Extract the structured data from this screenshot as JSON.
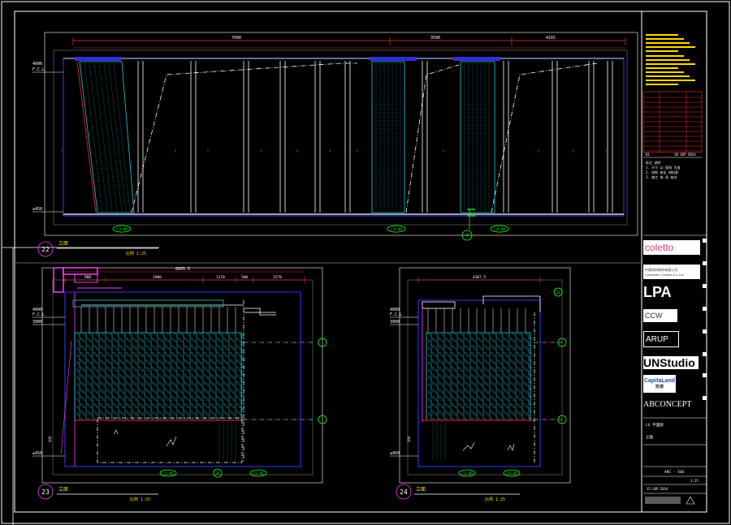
{
  "colors": {
    "background": "#000000",
    "frame": "#ffffff",
    "red": "#ff2a2a",
    "blue": "#2f2fd8",
    "cyan": "#26c9d6",
    "green": "#1aff1a",
    "magenta": "#ff3cff",
    "yellow": "#ffd800",
    "grey": "#7a7a7a"
  },
  "views": {
    "v22": {
      "number": "22",
      "title": "立面",
      "scale": "比例  1:25",
      "dims": [
        "7090",
        "3590",
        "4165"
      ],
      "level_top": [
        "4000",
        "F.C.L"
      ],
      "level_bottom": "±450",
      "tags": [
        "门1-04",
        "门1-09",
        "门1-09"
      ],
      "section_tag": "23"
    },
    "v23": {
      "number": "23",
      "title": "立面",
      "scale": "比例  1:25",
      "dims_top": "6895.5",
      "dims": [
        "900",
        "2900",
        "1170",
        "500",
        "1570"
      ],
      "level_top": [
        "4000",
        "F.C.L"
      ],
      "level_mid": "3900",
      "level_bottom": "±450",
      "side_dim": "200",
      "tags": [
        "门1-05",
        "门1-05"
      ],
      "section_tag": "24"
    },
    "v24": {
      "number": "24",
      "title": "立面",
      "scale": "比例  1:25",
      "dims_top": "4307.5",
      "level_top": [
        "4000",
        "F.C.L"
      ],
      "level_mid": "3900",
      "level_bottom": "±450",
      "side_dim": "200",
      "tags": [
        "门1-05",
        "门1-05"
      ],
      "section_tag": "23"
    }
  },
  "title_block": {
    "logos": [
      {
        "name": "coletto-logo",
        "text": "coletto",
        "style": "white"
      },
      {
        "name": "contractor-logo",
        "text": "中建深圳装饰有限公司",
        "sub": "Contractor Contact Co. Ltd",
        "style": "white"
      },
      {
        "name": "lpa-logo",
        "text": "LPA",
        "style": "dark"
      },
      {
        "name": "ccw-logo",
        "text": "CCW",
        "style": "white"
      },
      {
        "name": "arup-logo",
        "text": "ARUP",
        "style": "dark"
      },
      {
        "name": "unstudio-logo",
        "text": "UNStudio",
        "style": "white"
      },
      {
        "name": "capitaland-logo",
        "text": "CapitaLand",
        "sub": "凯德",
        "style": "white"
      },
      {
        "name": "abconcept-logo",
        "text": "ABCONCEPT",
        "style": "dark"
      }
    ],
    "notes": [
      "标注 说明",
      "1. 尺寸 以 现场 为准",
      "2. 材料 参见 材料表",
      "3. 施工 前 须 核对"
    ],
    "project": "LG 平面图",
    "drawing_title": "立面",
    "drawing_no": "ARC - 504",
    "scale_label": "1:25",
    "date": "15-SEP-2014",
    "revision_date": "18 SEP 2014",
    "rev": "01"
  }
}
